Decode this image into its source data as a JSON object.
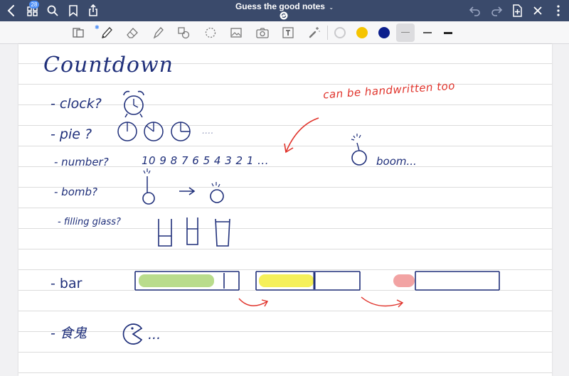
{
  "app": {
    "document_title": "Guess  the  good notes",
    "title_chevron": "⌄",
    "notes_badge": "28"
  },
  "toolbar": {
    "colors": [
      "#ffffff",
      "#f5c400",
      "#0b1e8c"
    ],
    "tools": [
      "reading-mode",
      "pen",
      "eraser",
      "highlighter",
      "shapes",
      "lasso",
      "image",
      "camera",
      "text",
      "elements"
    ]
  },
  "note": {
    "title": "Countdown",
    "items": {
      "clock": "- clock?",
      "pie": "- pie ?",
      "pie_ellipsis": "....",
      "number": "- number?",
      "countdown_digits": "10   9   8   7 6   5 4 3 2 1   ...",
      "boom": "boom...",
      "bomb": "- bomb?",
      "filling_glass": "- filling glass?",
      "bar": "- bar",
      "pacman_label": "- 食鬼",
      "pacman_ellipsis": "..."
    },
    "annotation": "can be handwritten too",
    "bars": [
      {
        "fill_color": "#b9dc8c",
        "filled_fraction": 0.9
      },
      {
        "fill_color": "#f5f05a",
        "filled_fraction": 0.55
      },
      {
        "fill_color": "#f2a3a3",
        "filled_fraction": 0.2
      }
    ]
  }
}
